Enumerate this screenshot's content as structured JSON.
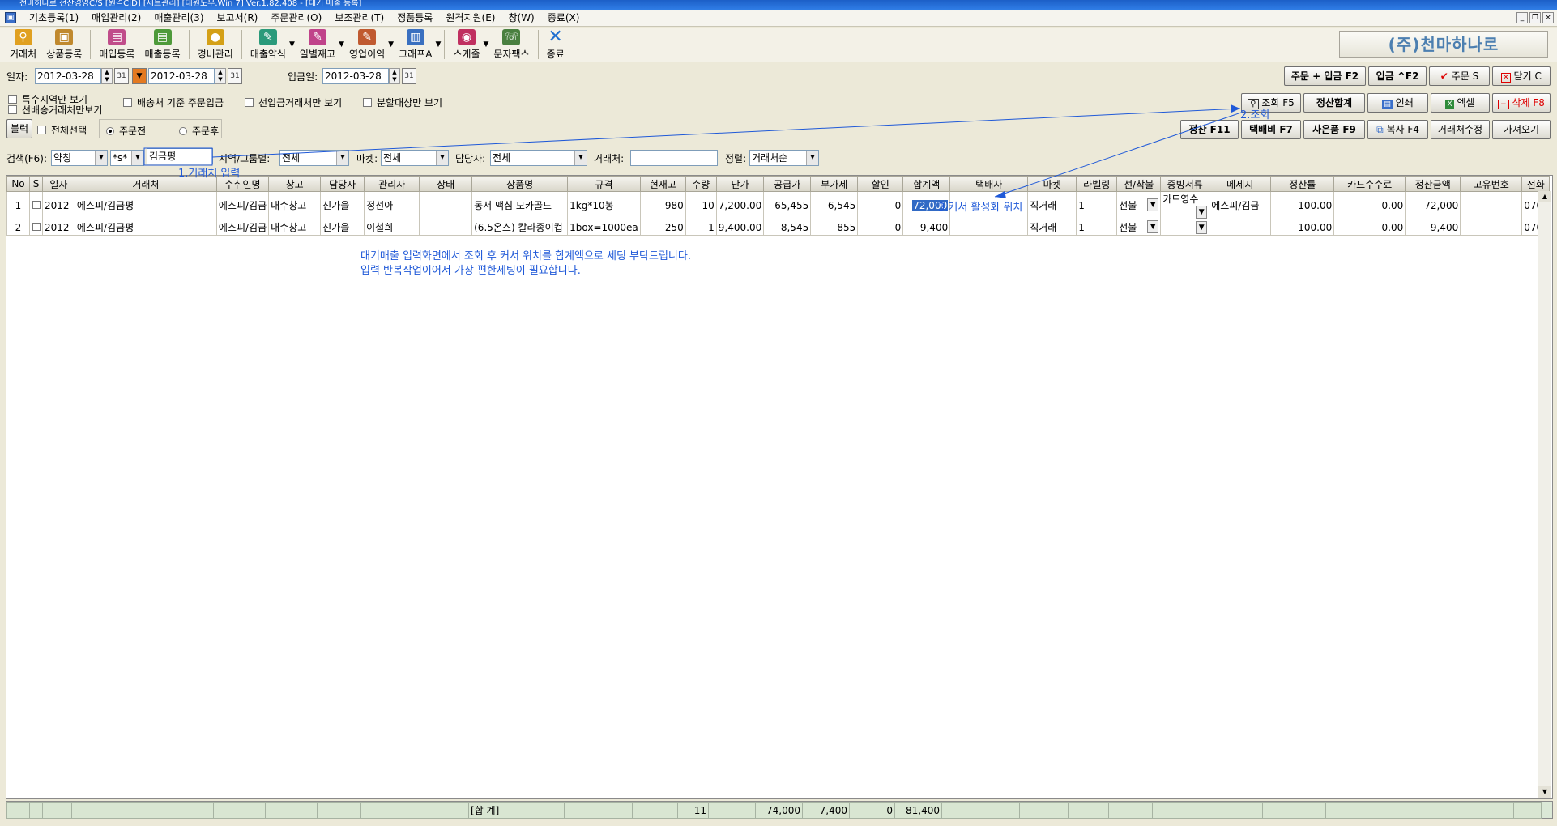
{
  "window": {
    "title": "천마하나로 전산경영C/S [원격CID] [세트관리] [대원도우.Win 7] Ver.1.82.408 - [대기 매출 등록]"
  },
  "menu": [
    "기초등록(1)",
    "매입관리(2)",
    "매출관리(3)",
    "보고서(R)",
    "주문관리(O)",
    "보조관리(T)",
    "정품등록",
    "원격지원(E)",
    "창(W)",
    "종료(X)"
  ],
  "toolbar": {
    "buttons": [
      {
        "label": "거래처",
        "icon": "binoculars-icon",
        "color": "#e0a020"
      },
      {
        "label": "상품등록",
        "icon": "box-icon",
        "color": "#c0892e"
      },
      {
        "label": "매입등록",
        "icon": "document-icon",
        "color": "#c04d8a"
      },
      {
        "label": "매출등록",
        "icon": "document-green-icon",
        "color": "#4e9a3a"
      },
      {
        "label": "경비관리",
        "icon": "coins-icon",
        "color": "#d4a017"
      },
      {
        "label": "매출약식",
        "icon": "pen-icon",
        "color": "#2a9a7a"
      },
      {
        "label": "일별재고",
        "icon": "pen-pink-icon",
        "color": "#c0438a"
      },
      {
        "label": "영업이익",
        "icon": "pen-notepad-icon",
        "color": "#c05a30"
      },
      {
        "label": "그래프A",
        "icon": "bar-chart-icon",
        "color": "#3a70c0"
      },
      {
        "label": "스케줄",
        "icon": "schedule-icon",
        "color": "#c03060"
      },
      {
        "label": "문자팩스",
        "icon": "phone-icon",
        "color": "#4a8040"
      },
      {
        "label": "종료",
        "icon": "close-x-icon",
        "color": "#1f6fd0"
      }
    ]
  },
  "company_name": "(주)천마하나로",
  "filters": {
    "date_label": "일자:",
    "date_from": "2012-03-28",
    "date_to": "2012-03-28",
    "deposit_label": "입금일:",
    "deposit_date": "2012-03-28",
    "chk_special": "특수지역만 보기",
    "chk_prepaid": "선배송거래처만보기",
    "chk_ship_order": "배송처 기준 주문입금",
    "chk_advance": "선입금거래처만 보기",
    "chk_split": "분할대상만 보기",
    "block_btn": "블럭",
    "chk_all": "전체선택",
    "radio_before": "주문전",
    "radio_after": "주문후",
    "search_label": "검색(F6):",
    "search_type": "약칭",
    "search_op": "*s*",
    "search_value": "김금평",
    "region_label": "지역/그룹별:",
    "region_value": "전체",
    "market_label": "마켓:",
    "market_value": "전체",
    "staff_label": "담당자:",
    "staff_value": "전체",
    "client_label": "거래처:",
    "client_value": "",
    "sort_label": "정렬:",
    "sort_value": "거래처순"
  },
  "buttons": {
    "order_deposit": "주문 + 입금 F2",
    "deposit": "입금 ^F2",
    "order": "주문 S",
    "close": "닫기 C",
    "search": "조회 F5",
    "settle_sum": "정산합계",
    "print": "인쇄",
    "excel": "엑셀",
    "delete": "삭제 F8",
    "settle": "정산 F11",
    "delivery": "택배비 F7",
    "gift": "사은품 F9",
    "copy": "복사 F4",
    "edit_client": "거래처수정",
    "import": "가져오기"
  },
  "grid": {
    "columns": [
      "No",
      "S",
      "일자",
      "거래처",
      "수취인명",
      "창고",
      "담당자",
      "관리자",
      "상태",
      "상품명",
      "규격",
      "현재고",
      "수량",
      "단가",
      "공급가",
      "부가세",
      "할인",
      "합계액",
      "택배사",
      "마켓",
      "라벨링",
      "선/착불",
      "증빙서류",
      "메세지",
      "정산률",
      "카드수수료",
      "정산금액",
      "고유번호",
      "전화"
    ],
    "rows": [
      {
        "no": "1",
        "date": "2012-",
        "client": "에스피/김금평",
        "receiver": "에스피/김금",
        "warehouse": "내수창고",
        "staff": "신가을",
        "manager": "정선아",
        "status": "",
        "product": "동서 맥심 모카골드",
        "spec": "1kg*10봉",
        "stock": "980",
        "qty": "10",
        "price": "7,200.00",
        "supply": "65,455",
        "vat": "6,545",
        "discount": "0",
        "total": "72,000",
        "courier": "",
        "market": "직거래",
        "label": "1",
        "pay": "선불",
        "proof": "카드영수",
        "message": "에스피/김금",
        "rate": "100.00",
        "card_fee": "0.00",
        "settle": "72,000",
        "uid": "",
        "phone": "070"
      },
      {
        "no": "2",
        "date": "2012-",
        "client": "에스피/김금평",
        "receiver": "에스피/김금",
        "warehouse": "내수창고",
        "staff": "신가을",
        "manager": "이철희",
        "status": "",
        "product": "(6.5온스) 칼라종이컵",
        "spec": "1box=1000ea",
        "stock": "250",
        "qty": "1",
        "price": "9,400.00",
        "supply": "8,545",
        "vat": "855",
        "discount": "0",
        "total": "9,400",
        "courier": "",
        "market": "직거래",
        "label": "1",
        "pay": "선불",
        "proof": "",
        "message": "",
        "rate": "100.00",
        "card_fee": "0.00",
        "settle": "9,400",
        "uid": "",
        "phone": "070"
      }
    ]
  },
  "footer": {
    "label": "[합 계]",
    "qty": "11",
    "supply": "74,000",
    "vat": "7,400",
    "discount": "0",
    "total": "81,400"
  },
  "annotations": {
    "step1": "1.거래처 입력",
    "step2": "2.조회",
    "step3": "3.커서 활성화 위치",
    "note_line1": "대기매출 입력화면에서 조회 후 커서 위치를 합계액으로 세팅 부탁드립니다.",
    "note_line2": "입력 반복작업이어서 가장 편한세팅이 필요합니다."
  }
}
